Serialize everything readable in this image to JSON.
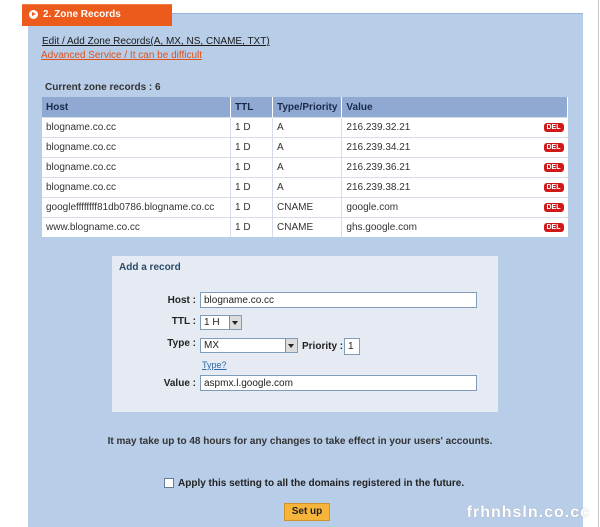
{
  "tab": {
    "title": "2. Zone Records"
  },
  "links": {
    "edit": "Edit / Add Zone Records(A, MX, NS, CNAME, TXT)",
    "advanced": "Advanced Service / It can be difficult"
  },
  "records": {
    "count_label": "Current zone records : 6",
    "columns": [
      "Host",
      "TTL",
      "Type/Priority",
      "Value"
    ],
    "del_label": "DEL",
    "rows": [
      {
        "host": "blogname.co.cc",
        "ttl": "1 D",
        "type": "A",
        "value": "216.239.32.21"
      },
      {
        "host": "blogname.co.cc",
        "ttl": "1 D",
        "type": "A",
        "value": "216.239.34.21"
      },
      {
        "host": "blogname.co.cc",
        "ttl": "1 D",
        "type": "A",
        "value": "216.239.36.21"
      },
      {
        "host": "blogname.co.cc",
        "ttl": "1 D",
        "type": "A",
        "value": "216.239.38.21"
      },
      {
        "host": "googleffffffff81db0786.blogname.co.cc",
        "ttl": "1 D",
        "type": "CNAME",
        "value": "google.com"
      },
      {
        "host": "www.blogname.co.cc",
        "ttl": "1 D",
        "type": "CNAME",
        "value": "ghs.google.com"
      }
    ]
  },
  "add": {
    "title": "Add a record",
    "host_label": "Host :",
    "host_value": "blogname.co.cc",
    "ttl_label": "TTL :",
    "ttl_value": "1 H",
    "type_label": "Type :",
    "type_value": "MX",
    "priority_label": "Priority :",
    "priority_value": "1",
    "type_help": "Type?",
    "value_label": "Value :",
    "value_value": "aspmx.l.google.com"
  },
  "info": "It may take up to 48 hours for any changes to take effect in your users' accounts.",
  "apply_label": "Apply this setting to all the domains registered in the future.",
  "setup_label": "Set up",
  "watermark": "frhnhsln.co.cc"
}
